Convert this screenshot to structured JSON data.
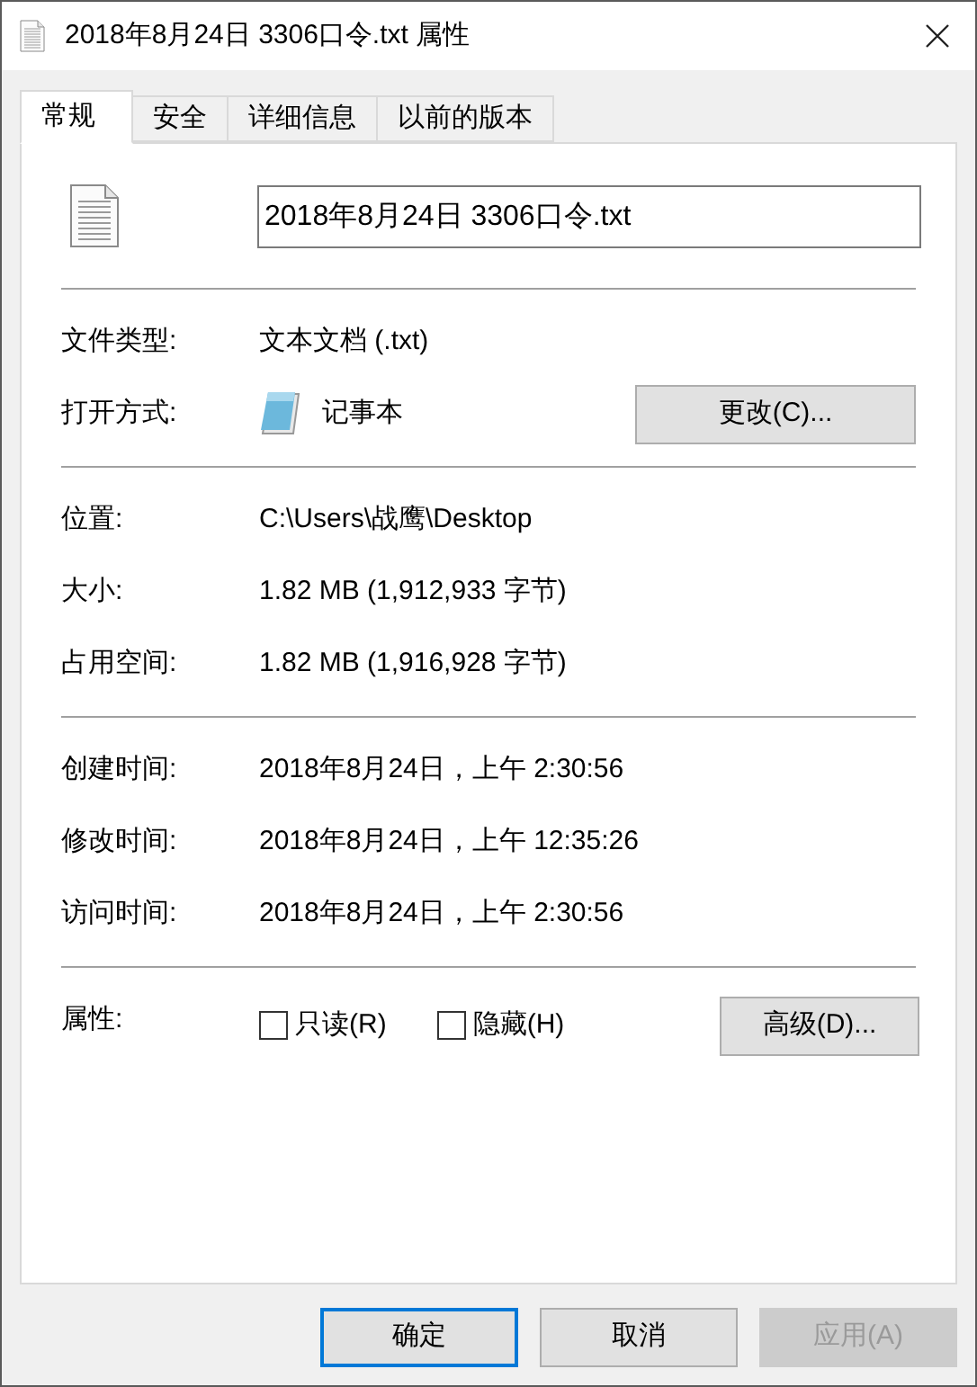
{
  "window": {
    "title": "2018年8月24日 3306口令.txt 属性"
  },
  "tabs": [
    {
      "label": "常规",
      "selected": true
    },
    {
      "label": "安全",
      "selected": false
    },
    {
      "label": "详细信息",
      "selected": false
    },
    {
      "label": "以前的版本",
      "selected": false
    }
  ],
  "file_name": {
    "value": "2018年8月24日 3306口令.txt"
  },
  "sections": [
    {
      "rows": [
        {
          "kind": "text",
          "label": "文件类型:",
          "value": "文本文档 (.txt)"
        },
        {
          "kind": "app",
          "label": "打开方式:",
          "value": "记事本",
          "button": "更改(C)..."
        }
      ]
    },
    {
      "rows": [
        {
          "kind": "text",
          "label": "位置:",
          "value": "C:\\Users\\战鹰\\Desktop"
        },
        {
          "kind": "text",
          "label": "大小:",
          "value": "1.82 MB (1,912,933 字节)"
        },
        {
          "kind": "text",
          "label": "占用空间:",
          "value": "1.82 MB (1,916,928 字节)"
        }
      ]
    },
    {
      "rows": [
        {
          "kind": "text",
          "label": "创建时间:",
          "value": "2018年8月24日，上午 2:30:56"
        },
        {
          "kind": "text",
          "label": "修改时间:",
          "value": "2018年8月24日，上午 12:35:26"
        },
        {
          "kind": "text",
          "label": "访问时间:",
          "value": "2018年8月24日，上午 2:30:56"
        }
      ]
    }
  ],
  "attributes": {
    "label": "属性:",
    "checkboxes": [
      {
        "label": "只读(R)",
        "checked": false
      },
      {
        "label": "隐藏(H)",
        "checked": false
      }
    ],
    "button": "高级(D)..."
  },
  "buttons": [
    {
      "label": "确定",
      "default": true,
      "disabled": false
    },
    {
      "label": "取消",
      "default": false,
      "disabled": false
    },
    {
      "label": "应用(A)",
      "default": false,
      "disabled": true
    }
  ]
}
